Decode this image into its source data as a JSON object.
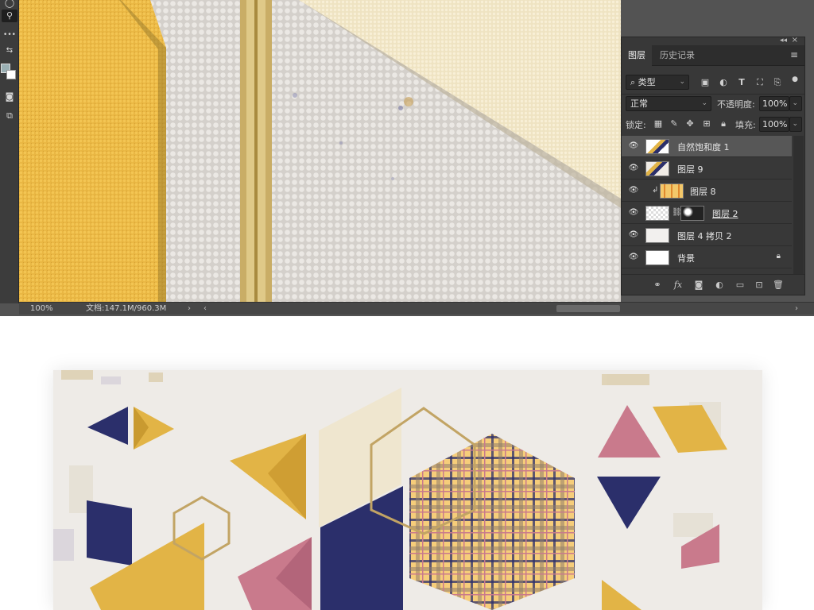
{
  "statusbar": {
    "zoom": "100%",
    "doc_info": "文档:147.1M/960.3M",
    "nav_arrow_left": "‹",
    "nav_arrow_right": "›",
    "scroll_left": "‹",
    "scroll_right": "›"
  },
  "layers_panel": {
    "tabs": [
      {
        "label": "图层",
        "active": true
      },
      {
        "label": "历史记录",
        "active": false
      }
    ],
    "filter": {
      "label": "类型",
      "icon": "search-icon"
    },
    "filter_icons": [
      "image-filter-icon",
      "adjustment-filter-icon",
      "type-filter-icon",
      "shape-filter-icon",
      "smart-object-filter-icon"
    ],
    "blend_mode": "正常",
    "opacity_label": "不透明度:",
    "opacity_value": "100%",
    "lock_label": "锁定:",
    "fill_label": "填充:",
    "fill_value": "100%",
    "layers": [
      {
        "name": "自然饱和度 1",
        "selected": true,
        "visible": true
      },
      {
        "name": "图层 9",
        "selected": false,
        "visible": true
      },
      {
        "name": "图层 8",
        "selected": false,
        "visible": true,
        "clipped": true
      },
      {
        "name": "图层 2",
        "selected": false,
        "visible": true,
        "masked": true
      },
      {
        "name": "图层 4 拷贝 2",
        "selected": false,
        "visible": true
      },
      {
        "name": "背景",
        "selected": false,
        "visible": true,
        "locked": true
      }
    ],
    "footer_icons": [
      "link-layers-icon",
      "fx-icon",
      "add-mask-icon",
      "new-adjustment-icon",
      "new-group-icon",
      "new-layer-icon",
      "delete-layer-icon"
    ]
  },
  "colors": {
    "mustard": "#e2b446",
    "navy": "#2b2f6b",
    "pink": "#c97a8c",
    "cream": "#efe6cf",
    "gold": "#c2a464",
    "ps_panel": "#383838",
    "ps_bg": "#535353"
  }
}
